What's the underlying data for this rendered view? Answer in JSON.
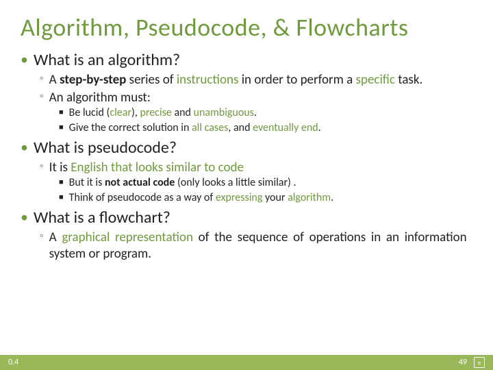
{
  "title": "Algorithm, Pseudocode, & Flowcharts",
  "sections": [
    {
      "q": "What is an algorithm?",
      "sub": [
        {
          "html": "A <span class='bold'>step-by-step</span> series of <span class='accent'>instructions</span> in order to perform a <span class='accent'>specific</span> task.",
          "justify": false
        },
        {
          "html": "An algorithm must:",
          "justify": false,
          "points": [
            {
              "html": "Be lucid (<span class='accent'>clear</span>), <span class='accent'>precise</span> and <span class='accent'>unambiguous</span>."
            },
            {
              "html": "Give the correct solution in <span class='accent'>all cases</span>, and <span class='accent'>eventually end</span>."
            }
          ]
        }
      ]
    },
    {
      "q": "What is pseudocode?",
      "sub": [
        {
          "html": "It is <span class='accent'>English that looks similar to code</span>",
          "justify": false,
          "points": [
            {
              "html": "But it is <span class='bold'>not actual code</span> (only looks a little similar) ."
            },
            {
              "html": "Think of pseudocode as a way of <span class='accent'>expressing</span> your <span class='accent'>algorithm</span>."
            }
          ]
        }
      ]
    },
    {
      "q": "What is a flowchart?",
      "sub": [
        {
          "html": "A <span class='accent'>graphical representation</span> of the sequence of operations in an information system or program.",
          "justify": true
        }
      ]
    }
  ],
  "footer": {
    "left": "0.4",
    "page": "49"
  }
}
